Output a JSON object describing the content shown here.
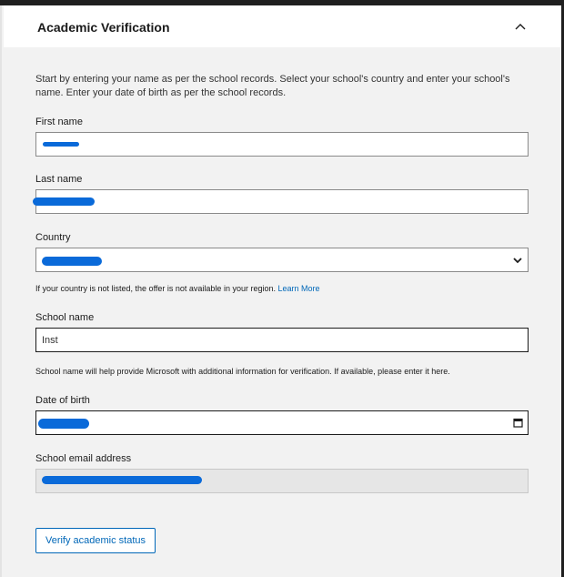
{
  "section": {
    "title": "Academic Verification",
    "intro": "Start by entering your name as per the school records. Select your school's country and enter your school's name. Enter your date of birth as per the school records."
  },
  "fields": {
    "first_name": {
      "label": "First name",
      "value": ""
    },
    "last_name": {
      "label": "Last name",
      "value": ""
    },
    "country": {
      "label": "Country",
      "selected": "",
      "hint_text": "If your country is not listed, the offer is not available in your region.",
      "hint_link": "Learn More"
    },
    "school_name": {
      "label": "School name",
      "value": "Inst",
      "hint": "School name will help provide Microsoft with additional information for verification. If available, please enter it here."
    },
    "date_of_birth": {
      "label": "Date of birth",
      "value": ""
    },
    "school_email": {
      "label": "School email address",
      "value": ""
    }
  },
  "actions": {
    "verify_label": "Verify academic status"
  },
  "icons": {
    "collapse": "chevron-up-icon",
    "select": "chevron-down-icon",
    "date": "calendar-icon"
  },
  "colors": {
    "accent": "#0067b8",
    "redaction": "#0a6ad9"
  }
}
